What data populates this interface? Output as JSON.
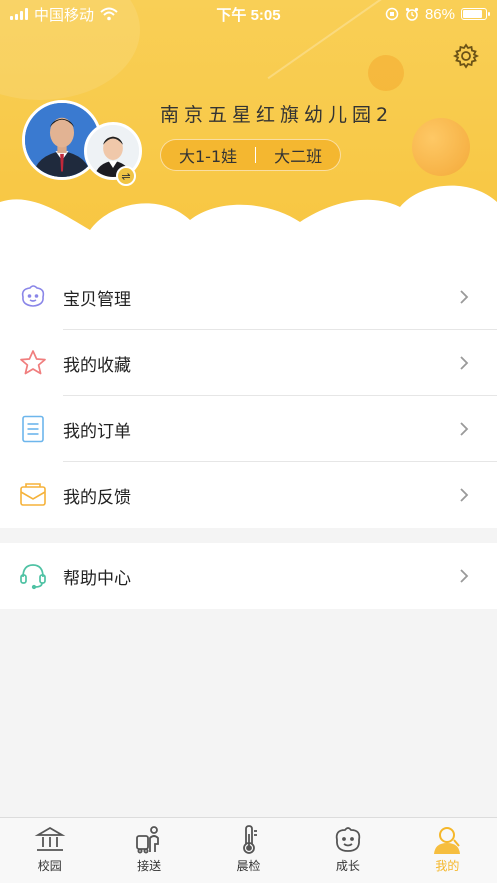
{
  "status_bar": {
    "carrier": "中国移动",
    "time": "下午 5:05",
    "battery_text": "86%",
    "battery_level": 0.86
  },
  "profile": {
    "school_name": "南京五星红旗幼儿园2",
    "child_name": "大1-1娃",
    "class_name": "大二班",
    "swap_icon_text": "⇌"
  },
  "menu": [
    {
      "label": "宝贝管理",
      "icon": "baby-icon"
    },
    {
      "label": "我的收藏",
      "icon": "star-icon"
    },
    {
      "label": "我的订单",
      "icon": "order-list-icon"
    },
    {
      "label": "我的反馈",
      "icon": "feedback-envelope-icon"
    }
  ],
  "menu2": [
    {
      "label": "帮助中心",
      "icon": "headset-icon"
    }
  ],
  "tabbar": {
    "items": [
      {
        "label": "校园",
        "icon": "campus-icon"
      },
      {
        "label": "接送",
        "icon": "pickup-icon"
      },
      {
        "label": "晨检",
        "icon": "thermometer-icon"
      },
      {
        "label": "成长",
        "icon": "growth-face-icon"
      },
      {
        "label": "我的",
        "icon": "profile-icon"
      }
    ],
    "active": "我的"
  },
  "colors": {
    "header_yellow": "#f8c94b",
    "accent": "#f5b72a",
    "pill": "#f4b730"
  }
}
